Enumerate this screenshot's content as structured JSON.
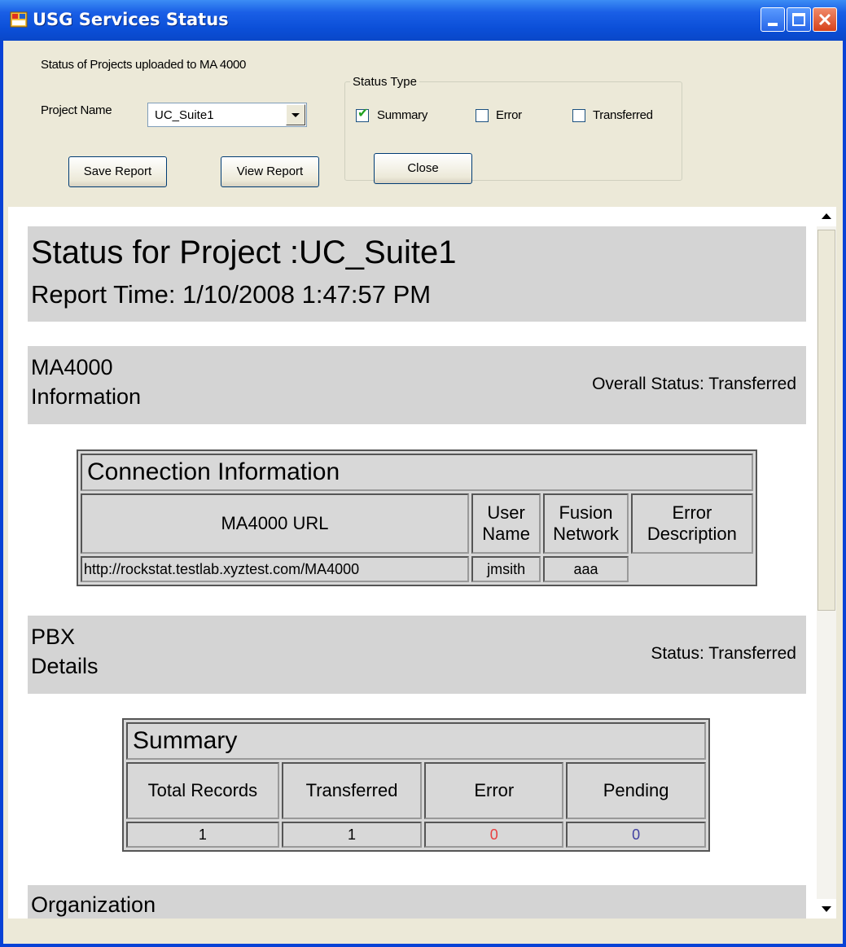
{
  "window": {
    "title": "USG Services Status",
    "controls": [
      "minimize",
      "maximize",
      "close"
    ]
  },
  "form": {
    "caption": "Status of Projects uploaded to MA 4000",
    "project_label": "Project Name",
    "project_value": "UC_Suite1",
    "status_type": {
      "title": "Status Type",
      "options": [
        {
          "label": "Summary",
          "checked": true
        },
        {
          "label": "Error",
          "checked": false
        },
        {
          "label": "Transferred",
          "checked": false
        }
      ]
    },
    "buttons": {
      "save": "Save Report",
      "view": "View Report",
      "close": "Close"
    }
  },
  "report": {
    "title": "Status for Project :UC_Suite1",
    "report_time": "Report Time: 1/10/2008 1:47:57 PM",
    "ma4000": {
      "heading_line1": "MA4000",
      "heading_line2": "Information",
      "status": "Overall Status: Transferred",
      "table": {
        "caption": "Connection Information",
        "headers": [
          "MA4000 URL",
          "User Name",
          "Fusion Network",
          "Error Description"
        ],
        "row": [
          "http://rockstat.testlab.xyztest.com/MA4000",
          "jmsith",
          "aaa",
          ""
        ]
      }
    },
    "pbx": {
      "heading_line1": "PBX",
      "heading_line2": "Details",
      "status": "Status: Transferred",
      "table": {
        "caption": "Summary",
        "headers": [
          "Total Records",
          "Transferred",
          "Error",
          "Pending"
        ],
        "row": [
          "1",
          "1",
          "0",
          "0"
        ]
      }
    },
    "organization": {
      "heading": "Organization"
    }
  },
  "colors": {
    "titlebar": "#0b4fd8",
    "error_value": "#e84040",
    "pending_value": "#4040a0",
    "section_bg": "#d4d4d4"
  }
}
